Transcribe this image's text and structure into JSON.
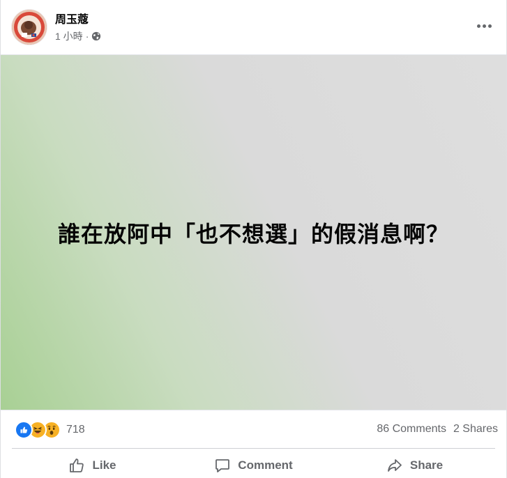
{
  "post": {
    "author": "周玉蔻",
    "timestamp": "1 小時",
    "separator": "·",
    "privacy_icon": "globe-icon",
    "more_icon": "more-options-icon",
    "content_text": "誰在放阿中「也不想選」的假消息啊？",
    "background_colors": [
      "#a8d094",
      "#dadada"
    ]
  },
  "stats": {
    "reaction_icons": [
      "like-icon",
      "haha-icon",
      "wow-icon"
    ],
    "reaction_count": "718",
    "comments": "86 Comments",
    "shares": "2 Shares"
  },
  "actions": {
    "like": "Like",
    "comment": "Comment",
    "share": "Share"
  },
  "colors": {
    "like_blue": "#1877f2",
    "emoji_yellow": "#f7b125",
    "secondary_text": "#65676b"
  }
}
